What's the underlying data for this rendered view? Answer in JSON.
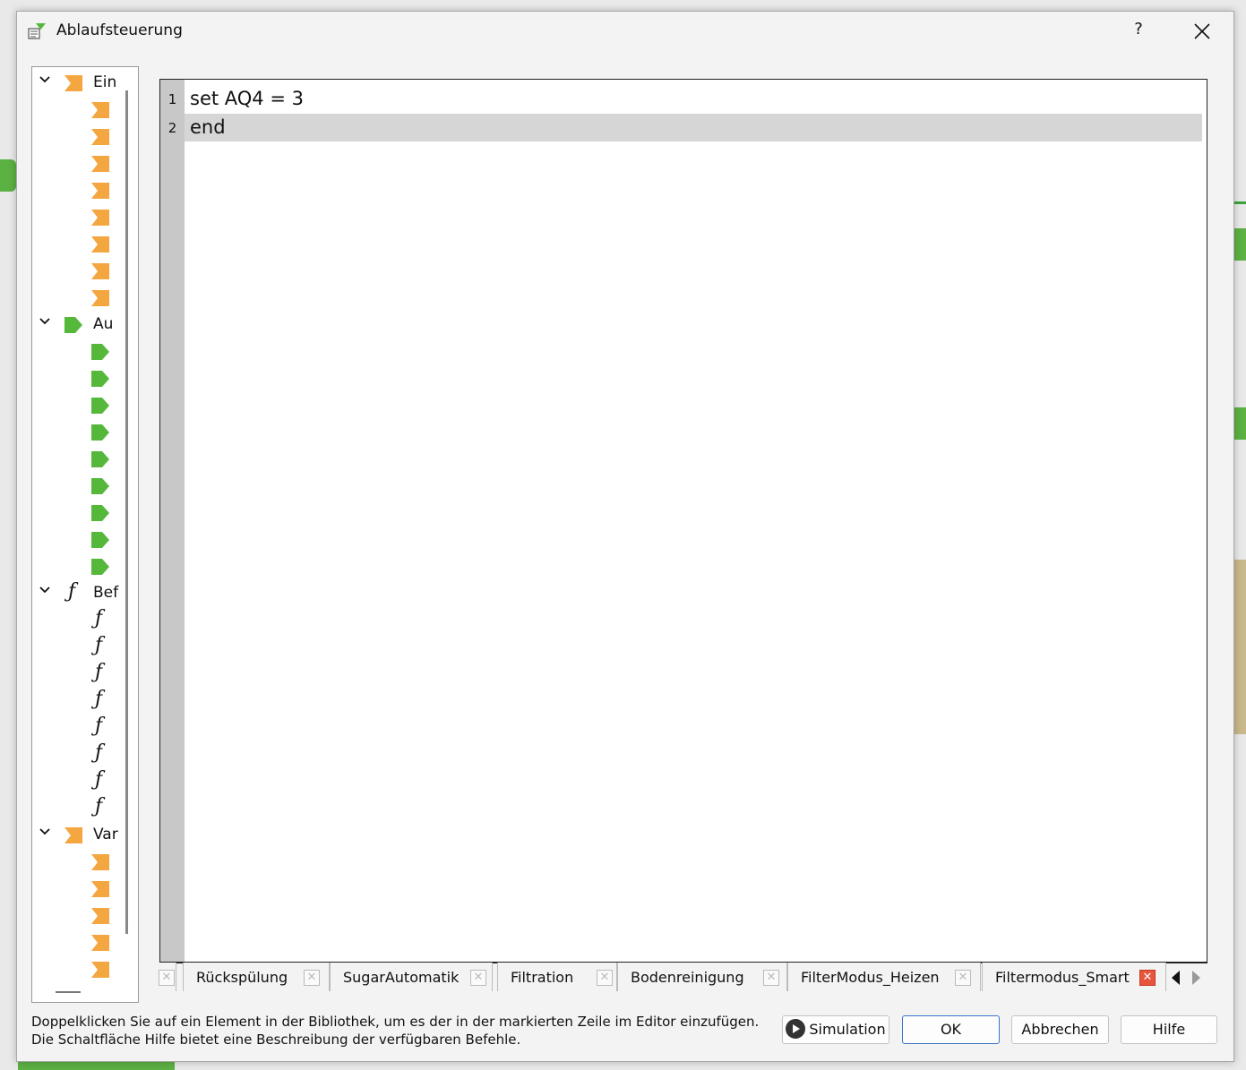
{
  "window": {
    "title": "Ablaufsteuerung",
    "help_label": "?",
    "close_label": "✕"
  },
  "library": {
    "groups": [
      {
        "label": "Ein",
        "icon": "orange-input-icon",
        "child_count": 8
      },
      {
        "label": "Au",
        "icon": "green-output-icon",
        "child_count": 9
      },
      {
        "label": "Bef",
        "icon": "function-icon",
        "child_count": 8
      },
      {
        "label": "Var",
        "icon": "orange-input-icon",
        "child_count": 5
      }
    ]
  },
  "editor": {
    "lines": [
      {
        "number": "1",
        "text": "set AQ4 = 3"
      },
      {
        "number": "2",
        "text": "end"
      }
    ],
    "current_line": 2
  },
  "tabs": [
    {
      "label": "Rückspülung",
      "active": false
    },
    {
      "label": "SugarAutomatik",
      "active": false
    },
    {
      "label": "Filtration",
      "active": false
    },
    {
      "label": "Bodenreinigung",
      "active": false
    },
    {
      "label": "FilterModus_Heizen",
      "active": false
    },
    {
      "label": "Filtermodus_Smart",
      "active": true
    }
  ],
  "tab_close_glyph": "✕",
  "footer": {
    "hint_line1": "Doppelklicken Sie auf ein Element in der Bibliothek, um es der in der markierten Zeile im Editor einzufügen.",
    "hint_line2": "Die Schaltfläche Hilfe bietet eine Beschreibung der verfügbaren Befehle.",
    "simulation": "Simulation",
    "ok": "OK",
    "cancel": "Abbrechen",
    "help": "Hilfe"
  },
  "colors": {
    "accent": "#3a74c8",
    "input_orange": "#f4a640",
    "output_green": "#55b83b",
    "close_red": "#e7553d",
    "highlight": "#d6d6d6",
    "gutter": "#c8c8c8"
  }
}
